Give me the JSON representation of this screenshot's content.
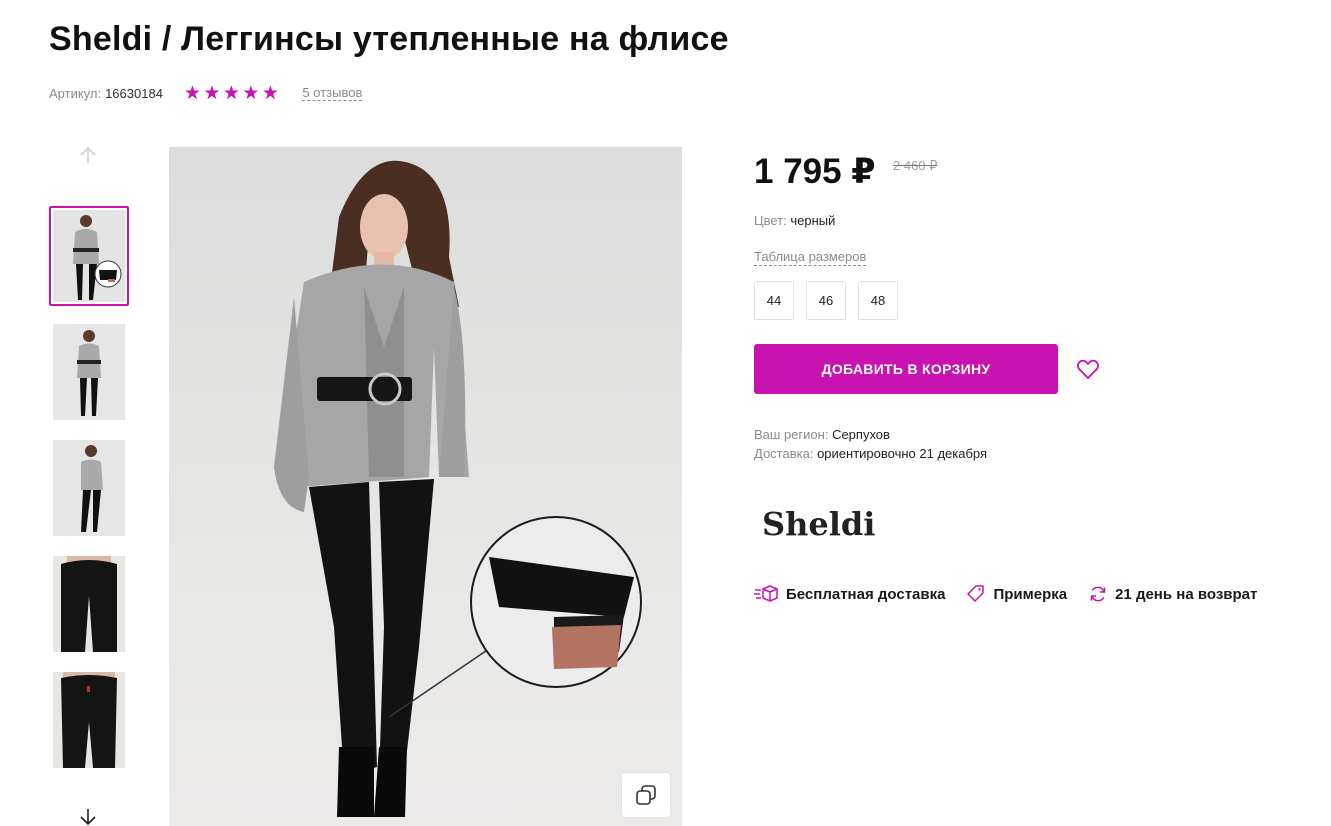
{
  "product": {
    "title": "Sheldi / Леггинсы утепленные на флисе",
    "sku_label": "Артикул:",
    "sku_value": "16630184",
    "rating": 5,
    "reviews_label": "5 отзывов"
  },
  "gallery": {
    "thumbnails": [
      {
        "label": "photo-1",
        "active": true
      },
      {
        "label": "photo-2",
        "active": false
      },
      {
        "label": "photo-3",
        "active": false
      },
      {
        "label": "photo-4",
        "active": false
      },
      {
        "label": "photo-5",
        "active": false
      }
    ],
    "up_icon": "arrow-up-icon",
    "down_icon": "arrow-down-icon",
    "zoom_icon": "copy-zoom-icon"
  },
  "pricing": {
    "price": "1 795 ₽",
    "old_price": "2 460 ₽"
  },
  "options": {
    "color_label": "Цвет:",
    "color_value": "черный",
    "size_table_label": "Таблица размеров",
    "sizes": [
      "44",
      "46",
      "48"
    ]
  },
  "actions": {
    "add_to_cart": "ДОБАВИТЬ В КОРЗИНУ",
    "wishlist_icon": "heart-icon"
  },
  "delivery": {
    "region_label": "Ваш регион:",
    "region_value": "Серпухов",
    "delivery_label": "Доставка:",
    "delivery_value": "ориентировочно 21 декабря"
  },
  "brand": {
    "name": "Sheldi"
  },
  "features": [
    {
      "icon": "delivery-box-icon",
      "label": "Бесплатная доставка"
    },
    {
      "icon": "tag-icon",
      "label": "Примерка"
    },
    {
      "icon": "refresh-icon",
      "label": "21 день на возврат"
    }
  ],
  "colors": {
    "accent": "#c813b0",
    "text": "#111111",
    "muted": "#8b8b8b"
  }
}
